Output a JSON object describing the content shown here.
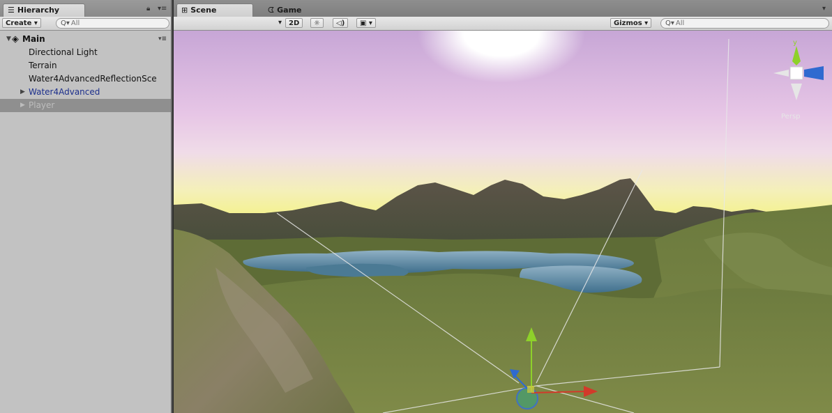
{
  "hierarchy": {
    "tab_label": "Hierarchy",
    "tab_icon": "list-icon",
    "create_label": "Create",
    "search_placeholder": "All",
    "scene": {
      "name": "Main"
    },
    "items": [
      {
        "label": "Directional Light",
        "expandable": false,
        "selected": false,
        "prefab": false
      },
      {
        "label": "Terrain",
        "expandable": false,
        "selected": false,
        "prefab": false
      },
      {
        "label": "Water4AdvancedReflectionSce",
        "expandable": false,
        "selected": false,
        "prefab": false
      },
      {
        "label": "Water4Advanced",
        "expandable": true,
        "selected": false,
        "prefab": true
      },
      {
        "label": "Player",
        "expandable": true,
        "selected": true,
        "prefab": true
      }
    ]
  },
  "scene_view": {
    "tabs": [
      {
        "label": "Scene",
        "icon": "grid-icon",
        "active": true
      },
      {
        "label": "Game",
        "icon": "pacman-icon",
        "active": false
      }
    ],
    "toolbar": {
      "mode_2d": "2D",
      "gizmos_label": "Gizmos",
      "search_placeholder": "All"
    },
    "gizmo_axes": {
      "y": "y",
      "projection": "Persp"
    }
  },
  "colors": {
    "axis_x": "#d23a2a",
    "axis_y": "#8ed12a",
    "axis_z": "#2f6ad0",
    "selection": "#8f8f8f"
  }
}
